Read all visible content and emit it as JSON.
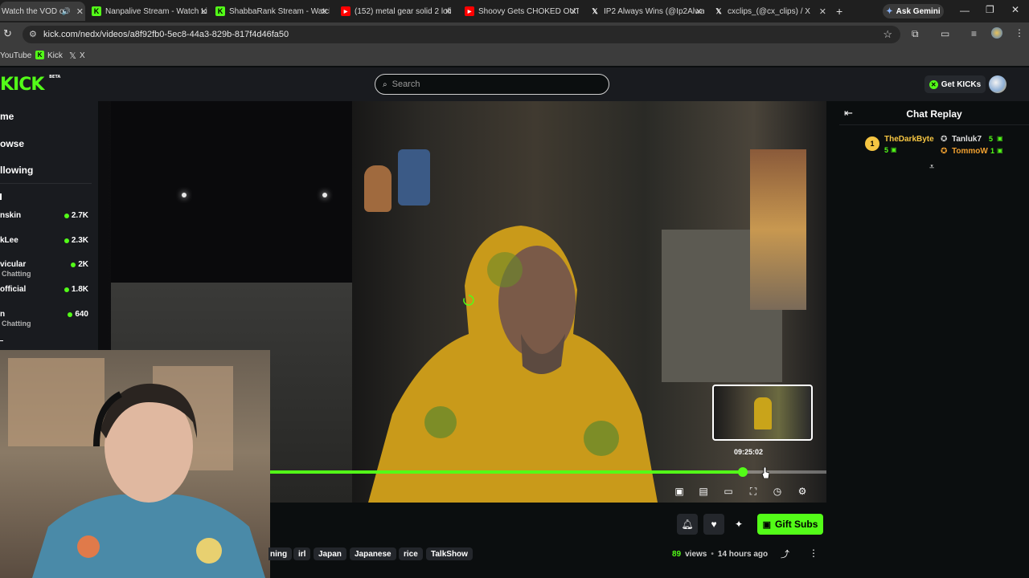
{
  "browser": {
    "tabs": [
      {
        "title": "Watch the VOD o",
        "favicon": "kick",
        "active": true
      },
      {
        "title": "Nanpalive Stream - Watch Li",
        "favicon": "kick"
      },
      {
        "title": "ShabbaRank Stream - Watch",
        "favicon": "kick"
      },
      {
        "title": "(152) metal gear solid 2 lofi s",
        "favicon": "youtube"
      },
      {
        "title": "Shoovy Gets CHOKED OUT",
        "favicon": "youtube"
      },
      {
        "title": "IP2 Always Wins (@Ip2Alwa",
        "favicon": "x"
      },
      {
        "title": "cxclips_(@cx_clips) / X",
        "favicon": "x"
      }
    ],
    "new_tab": "+",
    "ask_gemini": "Ask Gemini",
    "url": "kick.com/nedx/videos/a8f92fb0-5ec8-44a3-829b-817f4d46fa50",
    "bookmarks": [
      "YouTube",
      "Kick",
      "X"
    ]
  },
  "site": {
    "logo": "KICK",
    "logo_badge": "BETA",
    "search_placeholder": "Search",
    "get_kicks": "Get KICKs"
  },
  "sidebar": {
    "nav": [
      "me",
      "owse",
      "llowing"
    ],
    "channels": [
      {
        "name": "nskin",
        "viewers": "2.7K",
        "sub": ""
      },
      {
        "name": "kLee",
        "viewers": "2.3K",
        "sub": ""
      },
      {
        "name": "vicular",
        "viewers": "2K",
        "sub": "Chatting"
      },
      {
        "name": "official",
        "viewers": "1.8K",
        "sub": ""
      },
      {
        "name": "n",
        "viewers": "640",
        "sub": "Chatting"
      }
    ]
  },
  "player": {
    "hover_time": "09:25:02",
    "progress": 0.85,
    "hover_position": 0.88,
    "controls": [
      "miniplayer-icon",
      "theater-icon",
      "captions-icon",
      "fullscreen-icon",
      "speed-icon",
      "settings-icon"
    ]
  },
  "chat": {
    "title": "Chat Replay",
    "leaderboard": [
      {
        "rank": "1",
        "name": "TheDarkByte",
        "count": "5",
        "color": "#f5c542"
      },
      {
        "name": "Tanluk7",
        "count": "5",
        "color": "#e0e0e0"
      },
      {
        "name": "TommoW",
        "count": "1",
        "color": "#f0a030"
      }
    ]
  },
  "video_info": {
    "tags": [
      "ning",
      "irl",
      "Japan",
      "Japanese",
      "rice",
      "TalkShow"
    ],
    "views_count": "89",
    "views_label": "views",
    "separator": "•",
    "age": "14 hours ago",
    "gift_subs": "Gift Subs"
  },
  "colors": {
    "accent": "#53fc18",
    "background": "#0b0e0f",
    "panel": "#191b1f"
  }
}
